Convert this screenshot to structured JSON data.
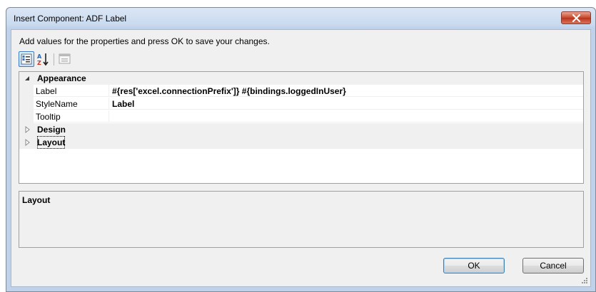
{
  "window": {
    "title": "Insert Component: ADF Label"
  },
  "instructions": "Add values for the properties and press OK to save your changes.",
  "grid": {
    "categories": [
      {
        "label": "Appearance",
        "expanded": true,
        "properties": [
          {
            "name": "Label",
            "value": "#{res['excel.connectionPrefix']} #{bindings.loggedInUser}"
          },
          {
            "name": "StyleName",
            "value": "Label"
          },
          {
            "name": "Tooltip",
            "value": ""
          }
        ]
      },
      {
        "label": "Design",
        "expanded": false
      },
      {
        "label": "Layout",
        "expanded": false,
        "focused": true
      }
    ]
  },
  "description": {
    "title": "Layout"
  },
  "buttons": {
    "ok": "OK",
    "cancel": "Cancel"
  },
  "icons": {
    "close": "close-icon",
    "categorized": "categorized-view-icon",
    "alphabetical": "sort-alphabetical-icon",
    "property_pages": "property-pages-icon"
  },
  "colors": {
    "title_bar": "#c9daef",
    "close_button": "#c8462c",
    "dialog_bg": "#f0f0f0",
    "grid_bg": "#ffffff"
  }
}
